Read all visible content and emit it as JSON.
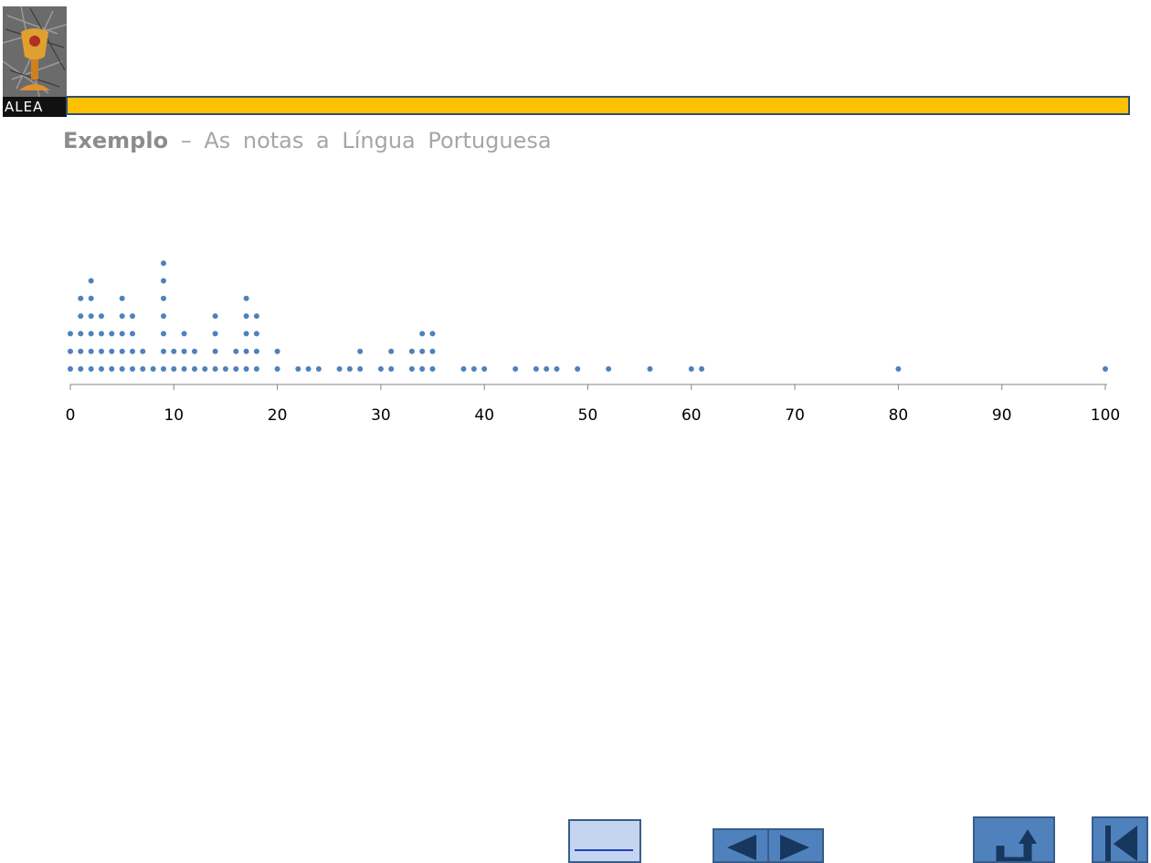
{
  "logo": {
    "text": "ALEA"
  },
  "heading": {
    "bold": "Exemplo",
    "rest": " – As notas a Língua Portuguesa"
  },
  "chart_data": {
    "type": "scatter",
    "title": "",
    "xlabel": "",
    "ylabel": "",
    "xlim": [
      0,
      100
    ],
    "x_ticks": [
      0,
      10,
      20,
      30,
      40,
      50,
      60,
      70,
      80,
      90,
      100
    ],
    "grid": false,
    "legend": "none",
    "marker_color": "#4f81bd",
    "description": "dot plot (stacked dots per value)",
    "points": [
      {
        "x": 0,
        "count": 3
      },
      {
        "x": 1,
        "count": 5
      },
      {
        "x": 2,
        "count": 6
      },
      {
        "x": 3,
        "count": 4
      },
      {
        "x": 4,
        "count": 3
      },
      {
        "x": 5,
        "count": 5
      },
      {
        "x": 6,
        "count": 4
      },
      {
        "x": 7,
        "count": 2
      },
      {
        "x": 8,
        "count": 1
      },
      {
        "x": 9,
        "count": 7
      },
      {
        "x": 10,
        "count": 2
      },
      {
        "x": 11,
        "count": 3
      },
      {
        "x": 12,
        "count": 2
      },
      {
        "x": 13,
        "count": 1
      },
      {
        "x": 14,
        "count": 4
      },
      {
        "x": 15,
        "count": 1
      },
      {
        "x": 16,
        "count": 2
      },
      {
        "x": 17,
        "count": 5
      },
      {
        "x": 18,
        "count": 4
      },
      {
        "x": 20,
        "count": 2
      },
      {
        "x": 22,
        "count": 1
      },
      {
        "x": 23,
        "count": 1
      },
      {
        "x": 24,
        "count": 1
      },
      {
        "x": 26,
        "count": 1
      },
      {
        "x": 27,
        "count": 1
      },
      {
        "x": 28,
        "count": 2
      },
      {
        "x": 30,
        "count": 1
      },
      {
        "x": 31,
        "count": 2
      },
      {
        "x": 33,
        "count": 2
      },
      {
        "x": 34,
        "count": 3
      },
      {
        "x": 35,
        "count": 3
      },
      {
        "x": 38,
        "count": 1
      },
      {
        "x": 39,
        "count": 1
      },
      {
        "x": 40,
        "count": 1
      },
      {
        "x": 43,
        "count": 1
      },
      {
        "x": 45,
        "count": 1
      },
      {
        "x": 46,
        "count": 1
      },
      {
        "x": 47,
        "count": 1
      },
      {
        "x": 49,
        "count": 1
      },
      {
        "x": 52,
        "count": 1
      },
      {
        "x": 56,
        "count": 1
      },
      {
        "x": 60,
        "count": 1
      },
      {
        "x": 61,
        "count": 1
      },
      {
        "x": 80,
        "count": 1
      },
      {
        "x": 100,
        "count": 1
      }
    ]
  },
  "nav": {
    "prev_icon": "triangle-left-icon",
    "next_icon": "triangle-right-icon",
    "return_icon": "u-turn-arrow-icon",
    "first_icon": "skip-to-start-icon"
  }
}
